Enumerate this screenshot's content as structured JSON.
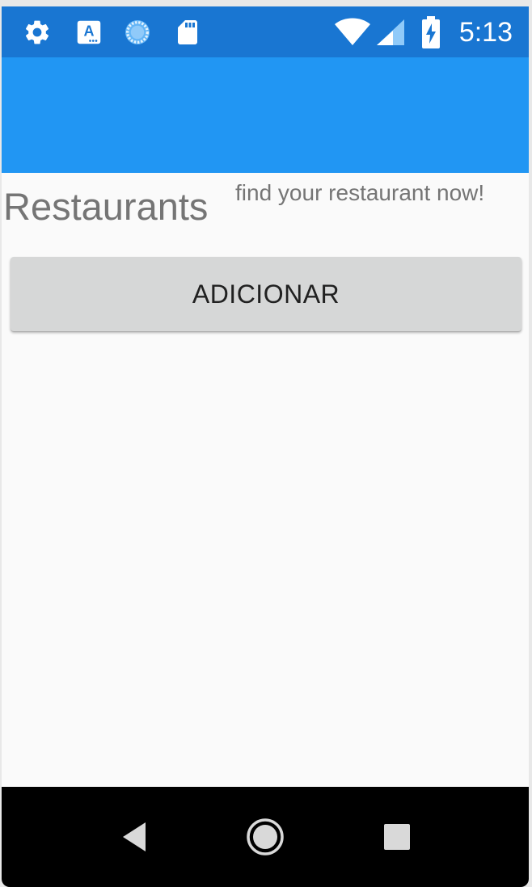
{
  "status_bar": {
    "time": "5:13",
    "icons": [
      "settings-icon",
      "keyboard-a-icon",
      "sync-loading-icon",
      "sd-card-icon",
      "wifi-icon",
      "cellular-signal-icon",
      "battery-charging-icon"
    ],
    "color": "#1976d2"
  },
  "app_bar": {
    "color": "#2196f3"
  },
  "main": {
    "title": "Restaurants",
    "tagline": "find your restaurant now!",
    "add_button_label": "ADICIONAR"
  },
  "nav_bar": {
    "buttons": [
      "back-icon",
      "home-icon",
      "recents-icon"
    ]
  }
}
